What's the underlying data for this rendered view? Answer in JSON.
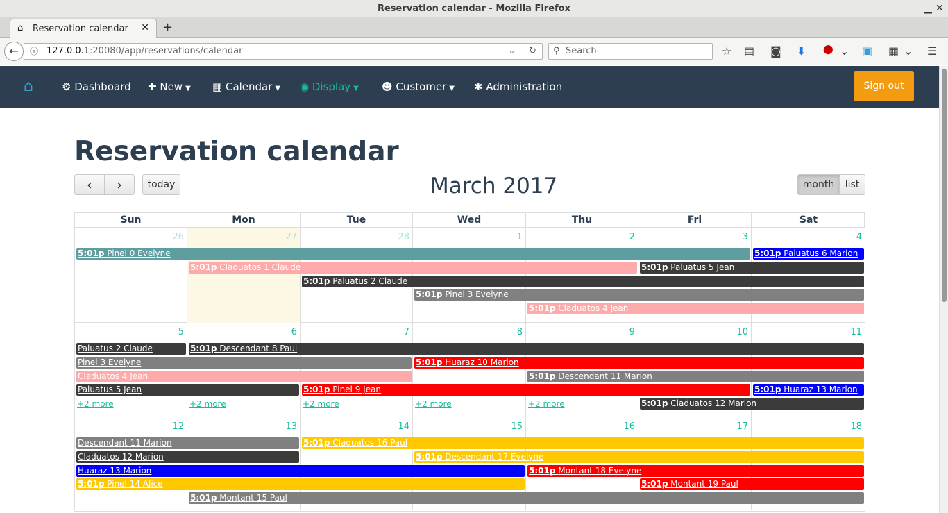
{
  "window": {
    "title": "Reservation calendar - Mozilla Firefox",
    "min": "▁",
    "max": "▢",
    "close": "✕"
  },
  "tabs": [
    {
      "label": "Reservation calendar",
      "icon": "home-icon",
      "close": "✕"
    }
  ],
  "newtab": "+",
  "browser": {
    "url_host": "127.0.0.1",
    "url_rest": ":20080/app/reservations/calendar",
    "search_placeholder": "Search"
  },
  "nav": {
    "items": [
      {
        "label": "Dashboard",
        "icon": "dashboard-icon",
        "glyph": "⚙",
        "caret": false
      },
      {
        "label": "New",
        "icon": "plus-icon",
        "glyph": "✚",
        "caret": true
      },
      {
        "label": "Calendar",
        "icon": "calendar-icon",
        "glyph": "▦",
        "caret": true
      },
      {
        "label": "Display",
        "icon": "eye-icon",
        "glyph": "◉",
        "caret": true,
        "active": true
      },
      {
        "label": "Customer",
        "icon": "users-icon",
        "glyph": "☻",
        "caret": true
      },
      {
        "label": "Administration",
        "icon": "cog-icon",
        "glyph": "✱",
        "caret": false
      }
    ],
    "signout": "Sign out",
    "colors": {
      "bg": "#2c3e50",
      "active": "#18bc9c",
      "signout": "#f39c12"
    }
  },
  "page": {
    "title": "Reservation calendar"
  },
  "calendar": {
    "title": "March 2017",
    "prev": "‹",
    "next": "›",
    "today": "today",
    "views": [
      "month",
      "list"
    ],
    "active_view": "month",
    "weekdays": [
      "Sun",
      "Mon",
      "Tue",
      "Wed",
      "Thu",
      "Fri",
      "Sat"
    ],
    "weeks": [
      {
        "days": [
          "26",
          "27",
          "28",
          "1",
          "2",
          "3",
          "4"
        ],
        "other": [
          true,
          true,
          true,
          false,
          false,
          false,
          false
        ],
        "today": 1,
        "events": [
          {
            "time": "5:01p",
            "label": "Pinel 0 Evelyne",
            "start": 0,
            "end": 5,
            "row": 0,
            "color": "#5f9ea0"
          },
          {
            "time": "5:01p",
            "label": "Paluatus 6 Marion",
            "start": 6,
            "end": 6,
            "row": 0,
            "color": "#0000ff"
          },
          {
            "time": "5:01p",
            "label": "Claduatos 1 Claude",
            "start": 1,
            "end": 4,
            "row": 1,
            "color": "#ffaaaa"
          },
          {
            "time": "5:01p",
            "label": "Paluatus 5 Jean",
            "start": 5,
            "end": 6,
            "row": 1,
            "color": "#3b3b3b"
          },
          {
            "time": "5:01p",
            "label": "Paluatus 2 Claude",
            "start": 2,
            "end": 6,
            "row": 2,
            "color": "#3b3b3b"
          },
          {
            "time": "5:01p",
            "label": "Pinel 3 Evelyne",
            "start": 3,
            "end": 6,
            "row": 3,
            "color": "#808080"
          },
          {
            "time": "5:01p",
            "label": "Claduatos 4 Jean",
            "start": 4,
            "end": 6,
            "row": 4,
            "color": "#ffaaaa"
          }
        ],
        "more": []
      },
      {
        "days": [
          "5",
          "6",
          "7",
          "8",
          "9",
          "10",
          "11"
        ],
        "other": [
          false,
          false,
          false,
          false,
          false,
          false,
          false
        ],
        "today": -1,
        "events": [
          {
            "time": "",
            "label": "Paluatus 2 Claude",
            "start": 0,
            "end": 0,
            "row": 0,
            "color": "#3b3b3b"
          },
          {
            "time": "5:01p",
            "label": "Descendant 8 Paul",
            "start": 1,
            "end": 6,
            "row": 0,
            "color": "#3b3b3b"
          },
          {
            "time": "",
            "label": "Pinel 3 Evelyne",
            "start": 0,
            "end": 2,
            "row": 1,
            "color": "#808080"
          },
          {
            "time": "5:01p",
            "label": "Huaraz 10 Marion",
            "start": 3,
            "end": 6,
            "row": 1,
            "color": "#ff0000"
          },
          {
            "time": "",
            "label": "Claduatos 4 Jean",
            "start": 0,
            "end": 2,
            "row": 2,
            "color": "#ffaaaa"
          },
          {
            "time": "5:01p",
            "label": "Descendant 11 Marion",
            "start": 4,
            "end": 6,
            "row": 2,
            "color": "#808080"
          },
          {
            "time": "",
            "label": "Paluatus 5 Jean",
            "start": 0,
            "end": 1,
            "row": 3,
            "color": "#3b3b3b"
          },
          {
            "time": "5:01p",
            "label": "Pinel 9 Jean",
            "start": 2,
            "end": 5,
            "row": 3,
            "color": "#ff0000"
          },
          {
            "time": "5:01p",
            "label": "Huaraz 13 Marion",
            "start": 6,
            "end": 6,
            "row": 3,
            "color": "#0000ff"
          },
          {
            "time": "5:01p",
            "label": "Claduatos 12 Marion",
            "start": 5,
            "end": 6,
            "row": 4,
            "color": "#3b3b3b"
          }
        ],
        "more": [
          {
            "day": 0,
            "label": "+2 more"
          },
          {
            "day": 1,
            "label": "+2 more"
          },
          {
            "day": 2,
            "label": "+2 more"
          },
          {
            "day": 3,
            "label": "+2 more"
          },
          {
            "day": 4,
            "label": "+2 more"
          }
        ]
      },
      {
        "days": [
          "12",
          "13",
          "14",
          "15",
          "16",
          "17",
          "18"
        ],
        "other": [
          false,
          false,
          false,
          false,
          false,
          false,
          false
        ],
        "today": -1,
        "events": [
          {
            "time": "",
            "label": "Descendant 11 Marion",
            "start": 0,
            "end": 1,
            "row": 0,
            "color": "#808080"
          },
          {
            "time": "5:01p",
            "label": "Claduatos 16 Paul",
            "start": 2,
            "end": 6,
            "row": 0,
            "color": "#ffc800"
          },
          {
            "time": "",
            "label": "Claduatos 12 Marion",
            "start": 0,
            "end": 1,
            "row": 1,
            "color": "#3b3b3b"
          },
          {
            "time": "5:01p",
            "label": "Descendant 17 Evelyne",
            "start": 3,
            "end": 6,
            "row": 1,
            "color": "#ffc800"
          },
          {
            "time": "",
            "label": "Huaraz 13 Marion",
            "start": 0,
            "end": 3,
            "row": 2,
            "color": "#0000ff"
          },
          {
            "time": "5:01p",
            "label": "Montant 18 Evelyne",
            "start": 4,
            "end": 6,
            "row": 2,
            "color": "#ff0000"
          },
          {
            "time": "5:01p",
            "label": "Pinel 14 Alice",
            "start": 0,
            "end": 3,
            "row": 3,
            "color": "#ffc800"
          },
          {
            "time": "5:01p",
            "label": "Montant 19 Paul",
            "start": 5,
            "end": 6,
            "row": 3,
            "color": "#ff0000"
          },
          {
            "time": "5:01p",
            "label": "Montant 15 Paul",
            "start": 1,
            "end": 6,
            "row": 4,
            "color": "#808080"
          }
        ],
        "more": []
      }
    ]
  }
}
